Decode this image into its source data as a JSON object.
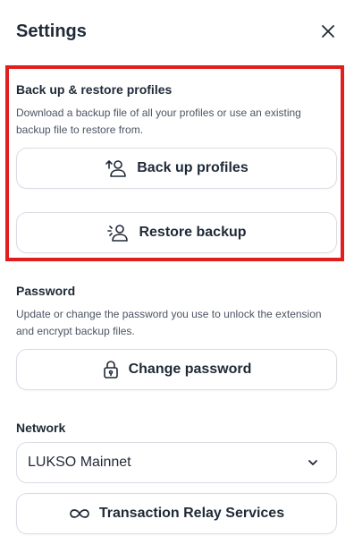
{
  "header": {
    "title": "Settings"
  },
  "backup": {
    "title": "Back up & restore profiles",
    "description": "Download a backup file of all your profiles or use an existing backup file to restore from.",
    "backup_button": "Back up profiles",
    "restore_button": "Restore backup"
  },
  "password": {
    "title": "Password",
    "description": "Update or change the password you use to unlock the extension and encrypt backup files.",
    "change_button": "Change password"
  },
  "network": {
    "title": "Network",
    "selected": "LUKSO Mainnet",
    "relay_button": "Transaction Relay Services"
  },
  "colors": {
    "highlight": "#e01e1e",
    "text": "#1f2a37",
    "muted": "#4b5563",
    "border": "#d9dde3"
  }
}
